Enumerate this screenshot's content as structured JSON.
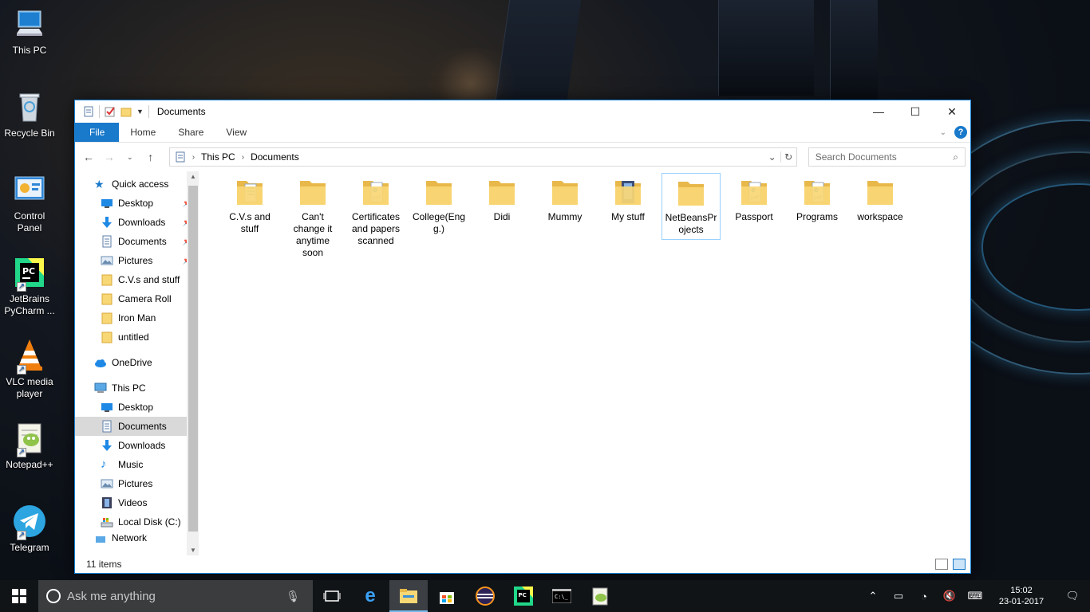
{
  "desktop": {
    "icons": [
      {
        "label": "This PC"
      },
      {
        "label": "Recycle Bin"
      },
      {
        "label": "Control Panel"
      },
      {
        "label": "JetBrains PyCharm ..."
      },
      {
        "label": "VLC media player"
      },
      {
        "label": "Notepad++"
      },
      {
        "label": "Telegram"
      }
    ]
  },
  "window": {
    "title": "Documents",
    "controls": {
      "minimize": "—",
      "maximize": "☐",
      "close": "✕"
    },
    "ribbon_tabs": [
      "File",
      "Home",
      "Share",
      "View"
    ],
    "breadcrumb": [
      "This PC",
      "Documents"
    ],
    "search_placeholder": "Search Documents"
  },
  "navpane": {
    "quick_access": "Quick access",
    "quick_items": [
      "Desktop",
      "Downloads",
      "Documents",
      "Pictures",
      "C.V.s and stuff",
      "Camera Roll",
      "Iron Man",
      "untitled"
    ],
    "onedrive": "OneDrive",
    "this_pc": "This PC",
    "pc_items": [
      "Desktop",
      "Documents",
      "Downloads",
      "Music",
      "Pictures",
      "Videos",
      "Local Disk (C:)"
    ],
    "network": "Network"
  },
  "files": [
    {
      "name": "C.V.s and stuff",
      "kind": "doc"
    },
    {
      "name": "Can't change it anytime soon",
      "kind": "plain"
    },
    {
      "name": "Certificates and papers scanned",
      "kind": "pdf"
    },
    {
      "name": "College(Engg.)",
      "kind": "plain"
    },
    {
      "name": "Didi",
      "kind": "plain"
    },
    {
      "name": "Mummy",
      "kind": "plain"
    },
    {
      "name": "My stuff",
      "kind": "dark"
    },
    {
      "name": "NetBeansProjects",
      "kind": "plain"
    },
    {
      "name": "Passport",
      "kind": "pdf"
    },
    {
      "name": "Programs",
      "kind": "pdf2"
    },
    {
      "name": "workspace",
      "kind": "plain"
    }
  ],
  "status": {
    "item_count": "11 items"
  },
  "taskbar": {
    "search_placeholder": "Ask me anything",
    "time": "15:02",
    "date": "23-01-2017"
  },
  "colors": {
    "accent": "#1979ca",
    "folder": "#f8d775",
    "folder_dark": "#e8b84a"
  }
}
